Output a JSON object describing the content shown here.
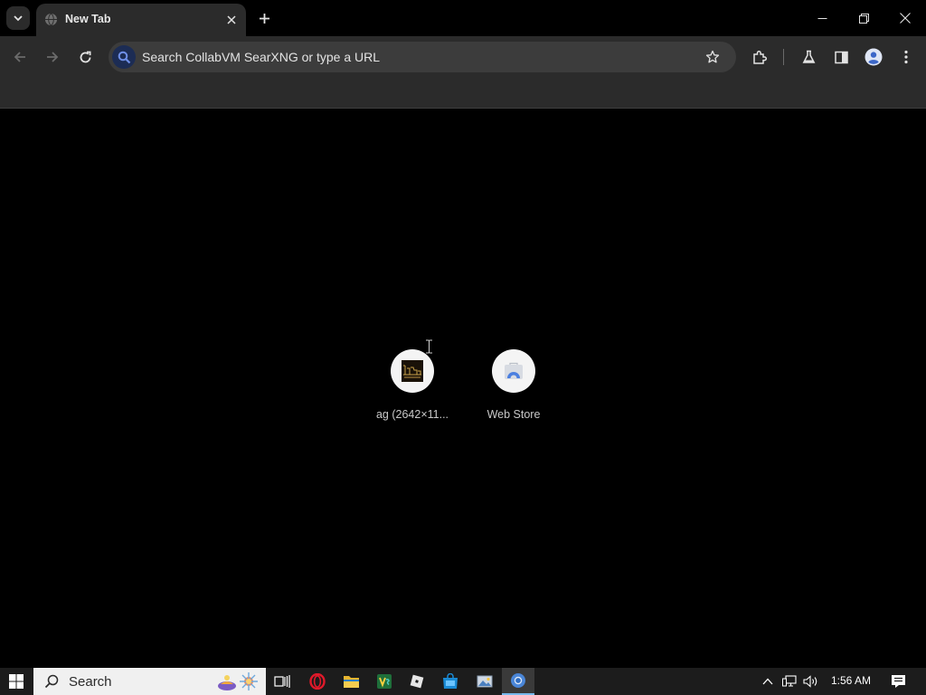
{
  "browser": {
    "tab": {
      "title": "New Tab"
    },
    "omnibox": {
      "placeholder": "Search CollabVM SearXNG or type a URL"
    }
  },
  "icons": {
    "tab_search": "chevron-down-icon",
    "tab_favicon": "globe-icon",
    "tab_close": "close-icon",
    "new_tab": "plus-icon",
    "back": "arrow-left-icon",
    "forward": "arrow-right-icon",
    "reload": "reload-icon",
    "omni_search": "search-icon",
    "bookmark": "star-icon",
    "extensions": "puzzle-icon",
    "labs": "flask-icon",
    "side_panel": "side-panel-icon",
    "profile": "avatar-icon",
    "menu": "kebab-menu-icon"
  },
  "shortcuts": [
    {
      "label": "ag (2642×11...",
      "icon": "image-thumbnail-icon"
    },
    {
      "label": "Web Store",
      "icon": "web-store-icon"
    }
  ],
  "taskbar": {
    "search_label": "Search",
    "clock": "1:56 AM",
    "apps": [
      "task-view",
      "opera",
      "file-explorer",
      "visual-studio",
      "roblox",
      "microsoft-store",
      "photos",
      "chromium"
    ]
  },
  "colors": {
    "toolbar": "#2b2b2b",
    "omnibox": "#3c3c3c",
    "content_bg": "#000000",
    "taskbar": "#1c1c1c",
    "accent": "#76b9ed"
  }
}
